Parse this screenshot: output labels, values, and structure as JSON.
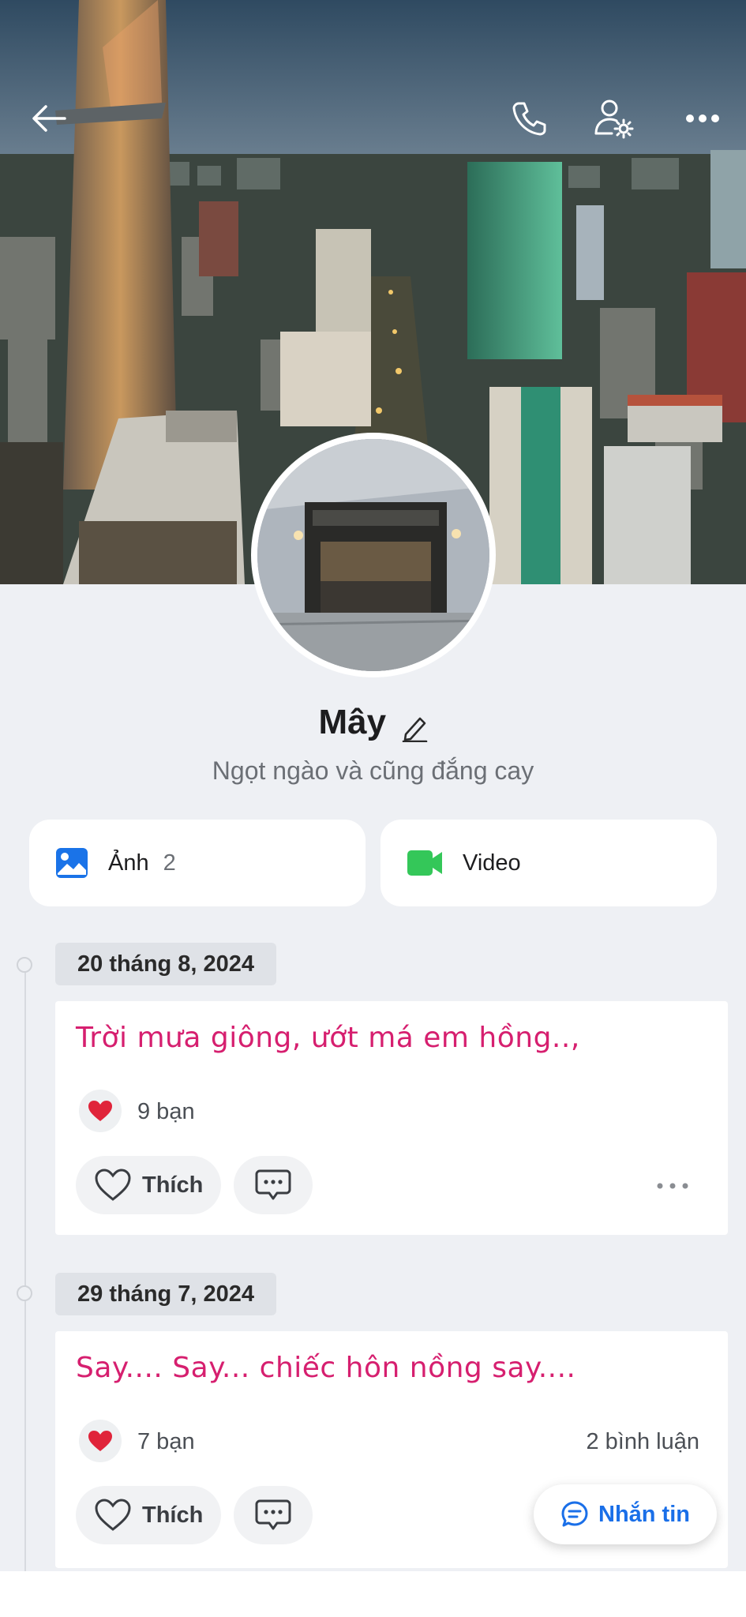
{
  "profile": {
    "name": "Mây",
    "status": "Ngọt ngào và cũng đắng cay"
  },
  "icons": {
    "back": "back-arrow-icon",
    "call": "phone-icon",
    "settings": "user-settings-icon",
    "more": "more-icon"
  },
  "tiles": {
    "photos_label": "Ảnh",
    "photos_count": "2",
    "video_label": "Video"
  },
  "posts": [
    {
      "date": "20 tháng 8, 2024",
      "text": "Trời mưa giông, ướt má em hồng..,",
      "reactions": "9 bạn",
      "comments": "",
      "like_label": "Thích"
    },
    {
      "date": "29 tháng 7, 2024",
      "text": "Say.... Say... chiếc hôn nồng say....",
      "reactions": "7 bạn",
      "comments": "2 bình luận",
      "like_label": "Thích"
    }
  ],
  "message_button": "Nhắn tin",
  "colors": {
    "post_text": "#d61f6f",
    "accent_blue": "#1a6fe8",
    "video_green": "#34c759",
    "photo_blue": "#1a73e8",
    "heart_red": "#e0243a"
  }
}
